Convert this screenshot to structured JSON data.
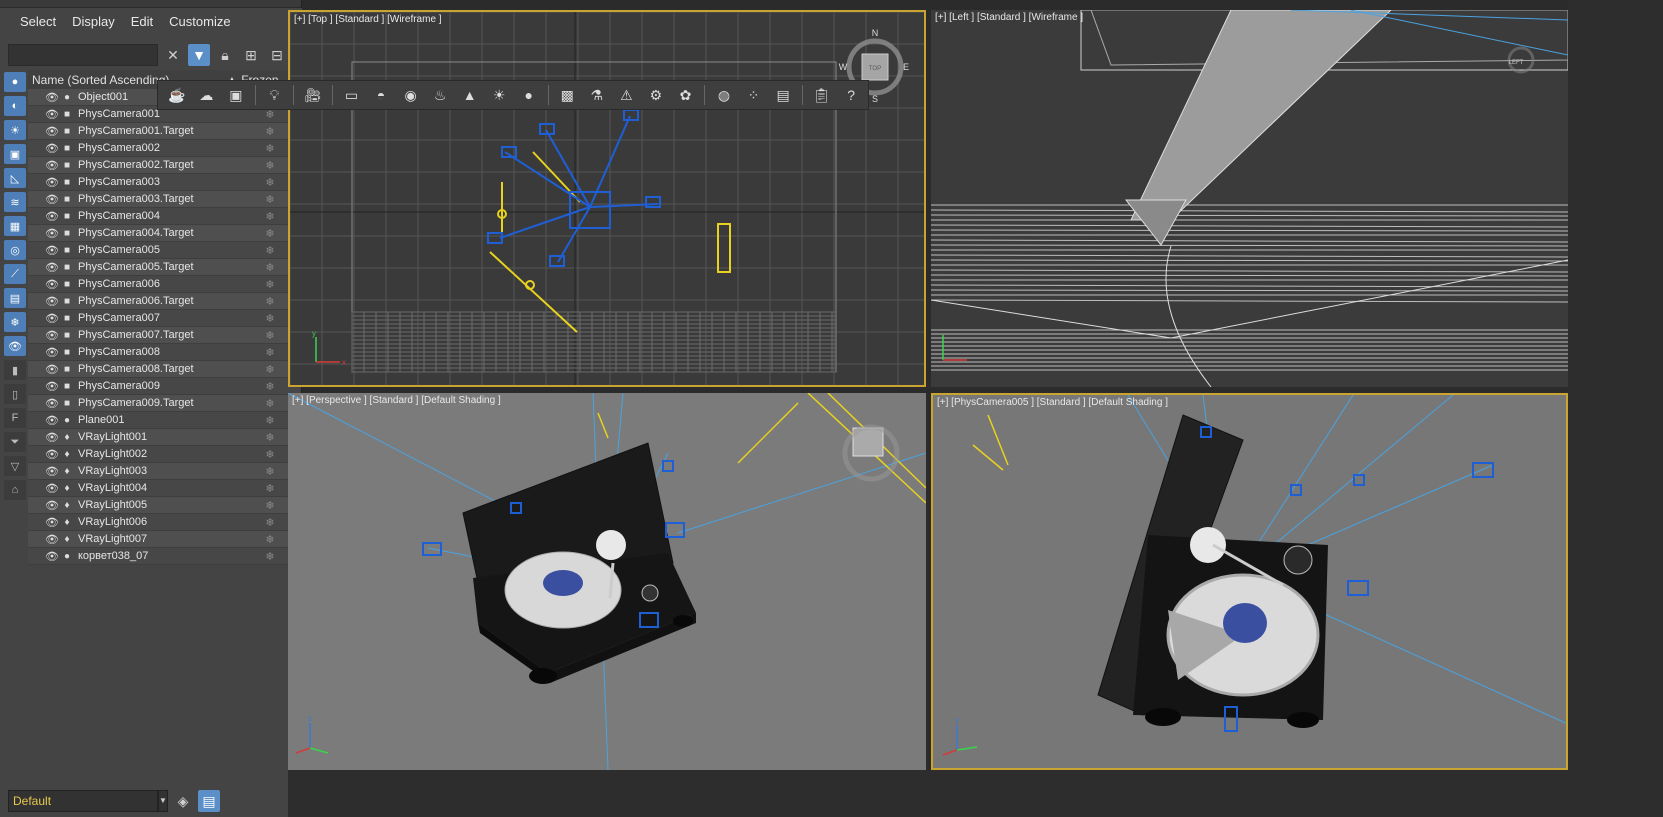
{
  "menu": [
    "Select",
    "Display",
    "Edit",
    "Customize"
  ],
  "list_header": {
    "name": "Name (Sorted Ascending)",
    "frozen": "▲ Frozen"
  },
  "objects": [
    {
      "name": "Object001",
      "icon": "●"
    },
    {
      "name": "PhysCamera001",
      "icon": "■"
    },
    {
      "name": "PhysCamera001.Target",
      "icon": "■"
    },
    {
      "name": "PhysCamera002",
      "icon": "■"
    },
    {
      "name": "PhysCamera002.Target",
      "icon": "■"
    },
    {
      "name": "PhysCamera003",
      "icon": "■"
    },
    {
      "name": "PhysCamera003.Target",
      "icon": "■"
    },
    {
      "name": "PhysCamera004",
      "icon": "■"
    },
    {
      "name": "PhysCamera004.Target",
      "icon": "■"
    },
    {
      "name": "PhysCamera005",
      "icon": "■"
    },
    {
      "name": "PhysCamera005.Target",
      "icon": "■"
    },
    {
      "name": "PhysCamera006",
      "icon": "■"
    },
    {
      "name": "PhysCamera006.Target",
      "icon": "■"
    },
    {
      "name": "PhysCamera007",
      "icon": "■"
    },
    {
      "name": "PhysCamera007.Target",
      "icon": "■"
    },
    {
      "name": "PhysCamera008",
      "icon": "■"
    },
    {
      "name": "PhysCamera008.Target",
      "icon": "■"
    },
    {
      "name": "PhysCamera009",
      "icon": "■"
    },
    {
      "name": "PhysCamera009.Target",
      "icon": "■"
    },
    {
      "name": "Plane001",
      "icon": "●"
    },
    {
      "name": "VRayLight001",
      "icon": "♦"
    },
    {
      "name": "VRayLight002",
      "icon": "♦"
    },
    {
      "name": "VRayLight003",
      "icon": "♦"
    },
    {
      "name": "VRayLight004",
      "icon": "♦"
    },
    {
      "name": "VRayLight005",
      "icon": "♦"
    },
    {
      "name": "VRayLight006",
      "icon": "♦"
    },
    {
      "name": "VRayLight007",
      "icon": "♦"
    },
    {
      "name": "корвет038_07",
      "icon": "●"
    }
  ],
  "layer": "Default",
  "viewports": {
    "top": "[+] [Top ] [Standard ] [Wireframe ]",
    "left": "[+] [Left ] [Standard ] [Wireframe ]",
    "perspective": "[+] [Perspective ] [Standard ] [Default Shading ]",
    "camera": "[+] [PhysCamera005 ] [Standard ] [Default Shading ]"
  },
  "viewcube": {
    "n": "N",
    "w": "W",
    "e": "E",
    "s": "S",
    "face": "TOP",
    "left_face": "LEFT"
  },
  "axis": {
    "x": "x",
    "y": "y",
    "z": "z"
  },
  "colors": {
    "selection_yellow": "#c9a431",
    "camera_blue": "#1f5fd6",
    "light_yellow": "#e8d21d",
    "highlight_blue": "#5b8fc7"
  }
}
